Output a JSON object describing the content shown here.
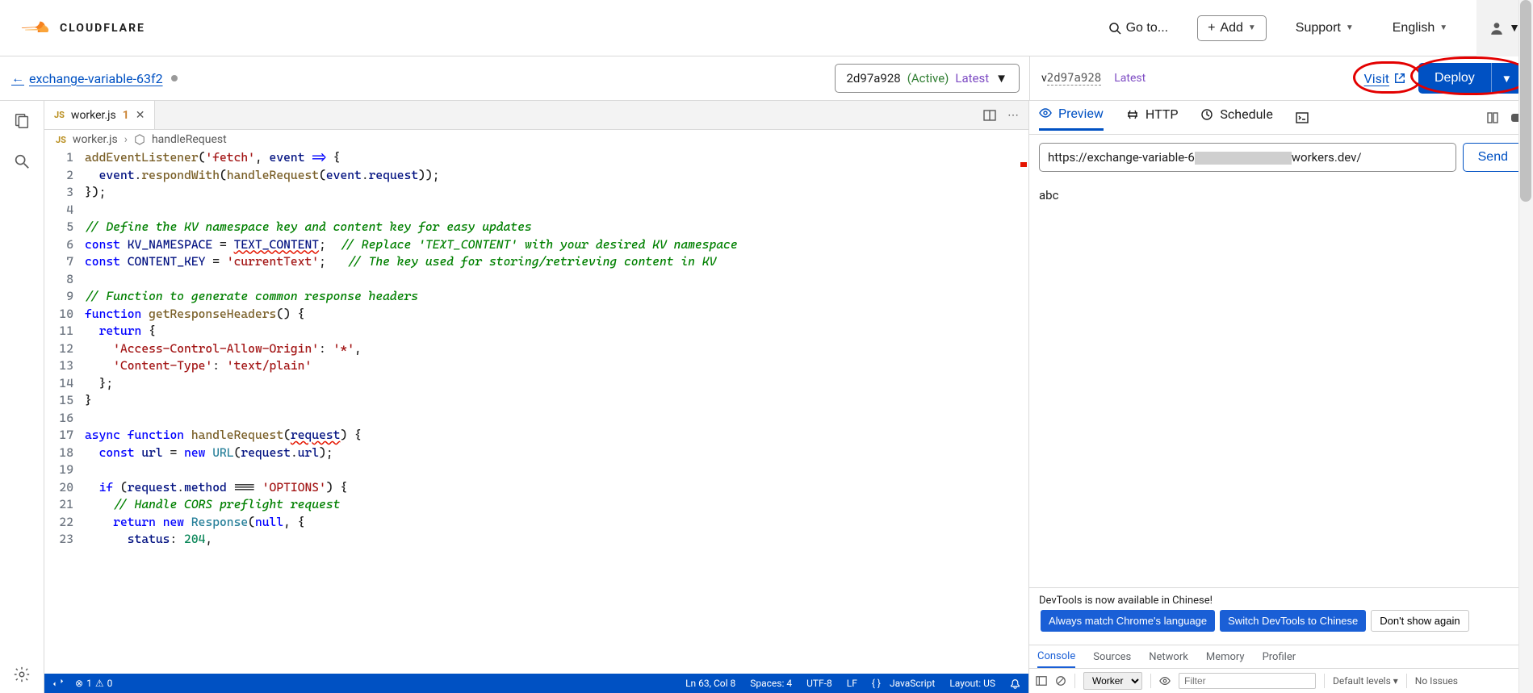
{
  "header": {
    "brand": "CLOUDFLARE",
    "goto": "Go to...",
    "add": "Add",
    "support": "Support",
    "language": "English"
  },
  "subheader": {
    "back_label": "exchange-variable-63f2",
    "version_hash": "2d97a928",
    "version_status": "(Active)",
    "version_channel": "Latest",
    "right_version_prefix": "v",
    "right_version_hash": "2d97a928",
    "right_channel": "Latest",
    "visit": "Visit",
    "deploy": "Deploy"
  },
  "editor": {
    "tab_file": "worker.js",
    "tab_modified": "1",
    "breadcrumb_file": "worker.js",
    "breadcrumb_symbol": "handleRequest",
    "lines": [
      {
        "n": 1,
        "h": "<span class='tk-fn'>addEventListener</span>(<span class='tk-str'>'fetch'</span>, <span class='tk-id'>event</span> <span class='tk-kw'>=&gt;</span> {"
      },
      {
        "n": 2,
        "h": "  <span class='tk-id'>event</span>.<span class='tk-fn'>respondWith</span>(<span class='tk-fn'>handleRequest</span>(<span class='tk-id'>event</span>.<span class='tk-id'>request</span>));"
      },
      {
        "n": 3,
        "h": "});"
      },
      {
        "n": 4,
        "h": ""
      },
      {
        "n": 5,
        "h": "<span class='tk-cm'>// Define the KV namespace key and content key for easy updates</span>"
      },
      {
        "n": 6,
        "h": "<span class='tk-kw'>const</span> <span class='tk-id'>KV_NAMESPACE</span> = <span class='tk-id tk-err'>TEXT_CONTENT</span>;  <span class='tk-cm'>// Replace 'TEXT_CONTENT' with your desired KV namespace</span>"
      },
      {
        "n": 7,
        "h": "<span class='tk-kw'>const</span> <span class='tk-id'>CONTENT_KEY</span> = <span class='tk-str'>'currentText'</span>;   <span class='tk-cm'>// The key used for storing/retrieving content in KV</span>"
      },
      {
        "n": 8,
        "h": ""
      },
      {
        "n": 9,
        "h": "<span class='tk-cm'>// Function to generate common response headers</span>"
      },
      {
        "n": 10,
        "h": "<span class='tk-kw'>function</span> <span class='tk-fn'>getResponseHeaders</span>() {"
      },
      {
        "n": 11,
        "h": "  <span class='tk-kw'>return</span> {"
      },
      {
        "n": 12,
        "h": "    <span class='tk-str'>'Access-Control-Allow-Origin'</span>: <span class='tk-str'>'*'</span>,"
      },
      {
        "n": 13,
        "h": "    <span class='tk-str'>'Content-Type'</span>: <span class='tk-str'>'text/plain'</span>"
      },
      {
        "n": 14,
        "h": "  };"
      },
      {
        "n": 15,
        "h": "}"
      },
      {
        "n": 16,
        "h": ""
      },
      {
        "n": 17,
        "h": "<span class='tk-kw'>async</span> <span class='tk-kw'>function</span> <span class='tk-fn'>handleRequest</span>(<span class='tk-id tk-err'>request</span>) {"
      },
      {
        "n": 18,
        "h": "  <span class='tk-kw'>const</span> <span class='tk-id'>url</span> = <span class='tk-kw'>new</span> <span class='tk-cls'>URL</span>(<span class='tk-id'>request</span>.<span class='tk-id'>url</span>);"
      },
      {
        "n": 19,
        "h": ""
      },
      {
        "n": 20,
        "h": "  <span class='tk-kw'>if</span> (<span class='tk-id'>request</span>.<span class='tk-id'>method</span> === <span class='tk-str'>'OPTIONS'</span>) {"
      },
      {
        "n": 21,
        "h": "    <span class='tk-cm'>// Handle CORS preflight request</span>"
      },
      {
        "n": 22,
        "h": "    <span class='tk-kw'>return</span> <span class='tk-kw'>new</span> <span class='tk-cls'>Response</span>(<span class='tk-kw'>null</span>, {"
      },
      {
        "n": 23,
        "h": "      <span class='tk-id'>status</span>: <span class='tk-num'>204</span>,"
      }
    ]
  },
  "statusbar": {
    "errors": "1",
    "warnings": "0",
    "pos": "Ln 63, Col 8",
    "spaces": "Spaces: 4",
    "encoding": "UTF-8",
    "eol": "LF",
    "lang": "JavaScript",
    "layout": "Layout: US"
  },
  "preview": {
    "tabs": [
      "Preview",
      "HTTP",
      "Schedule"
    ],
    "url_pre": "https://exchange-variable-6",
    "url_post": "workers.dev/",
    "send": "Send",
    "body": "abc"
  },
  "devtools": {
    "banner": "DevTools is now available in Chinese!",
    "btn1": "Always match Chrome's language",
    "btn2": "Switch DevTools to Chinese",
    "btn3": "Don't show again",
    "tabs": [
      "Console",
      "Sources",
      "Network",
      "Memory",
      "Profiler"
    ],
    "context": "Worker",
    "filter_placeholder": "Filter",
    "levels": "Default levels",
    "issues": "No Issues"
  }
}
